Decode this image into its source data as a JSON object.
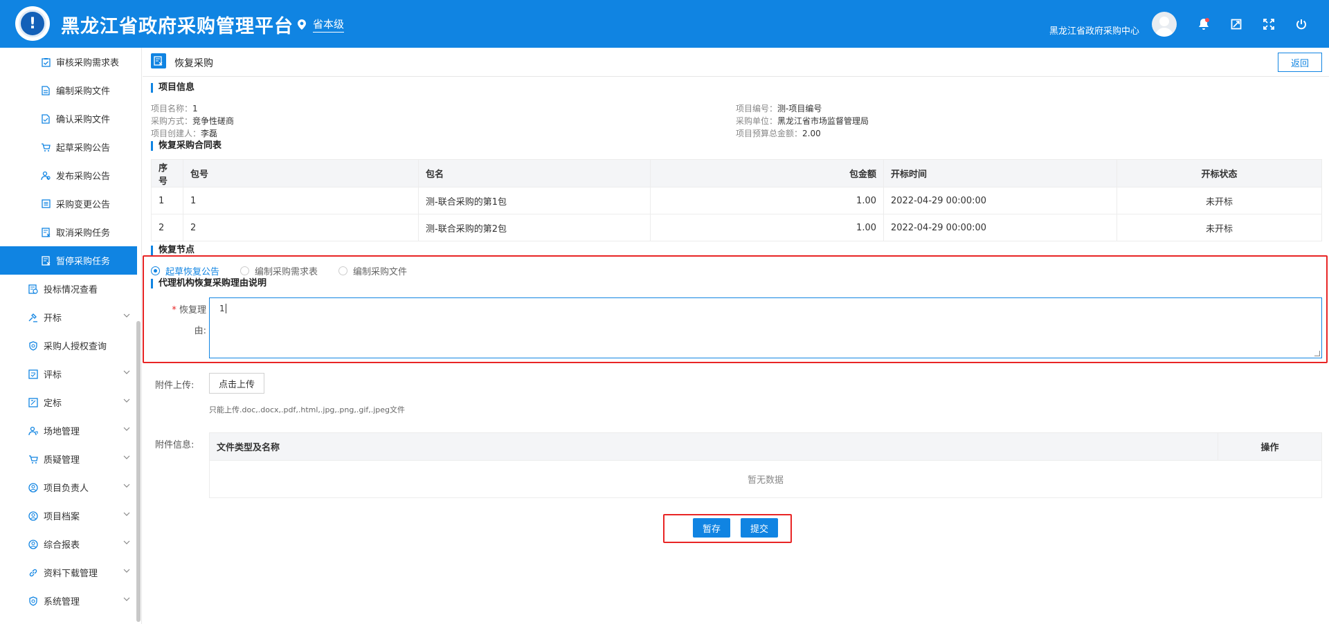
{
  "header": {
    "app_title": "黑龙江省政府采购管理平台",
    "region": "省本级",
    "user_org": "黑龙江省政府采购中心",
    "bg_color": "#1084e2"
  },
  "sidebar": {
    "sub_items": [
      {
        "label": "审核采购需求表",
        "icon": "checklist-icon"
      },
      {
        "label": "编制采购文件",
        "icon": "document-icon"
      },
      {
        "label": "确认采购文件",
        "icon": "document-check-icon"
      },
      {
        "label": "起草采购公告",
        "icon": "cart-icon"
      },
      {
        "label": "发布采购公告",
        "icon": "users-icon"
      },
      {
        "label": "采购变更公告",
        "icon": "list-icon"
      },
      {
        "label": "取消采购任务",
        "icon": "cancel-doc-icon"
      },
      {
        "label": "暂停采购任务",
        "icon": "pause-doc-icon",
        "active": true
      }
    ],
    "top_items": [
      {
        "label": "投标情况查看",
        "icon": "bid-icon",
        "expandable": false
      },
      {
        "label": "开标",
        "icon": "hammer-icon",
        "expandable": true
      },
      {
        "label": "采购人授权查询",
        "icon": "shield-icon",
        "expandable": false
      },
      {
        "label": "评标",
        "icon": "evaluate-icon",
        "expandable": true
      },
      {
        "label": "定标",
        "icon": "award-icon",
        "expandable": true
      },
      {
        "label": "场地管理",
        "icon": "venue-icon",
        "expandable": true
      },
      {
        "label": "质疑管理",
        "icon": "cart-icon",
        "expandable": true
      },
      {
        "label": "项目负责人",
        "icon": "user-circle-icon",
        "expandable": true
      },
      {
        "label": "项目档案",
        "icon": "user-circle-icon",
        "expandable": true
      },
      {
        "label": "综合报表",
        "icon": "user-circle-icon",
        "expandable": true
      },
      {
        "label": "资料下载管理",
        "icon": "link-icon",
        "expandable": true
      },
      {
        "label": "系统管理",
        "icon": "settings-shield-icon",
        "expandable": true
      }
    ]
  },
  "page": {
    "title": "恢复采购",
    "back_label": "返回"
  },
  "project_info": {
    "section_title": "项目信息",
    "name_label": "项目名称：",
    "name": "1",
    "method_label": "采购方式：",
    "method": "竞争性磋商",
    "creator_label": "项目创建人：",
    "creator": "李磊",
    "code_label": "项目编号：",
    "code": "测-项目编号",
    "unit_label": "采购单位：",
    "unit": "黑龙江省市场监督管理局",
    "budget_label": "项目预算总金额：",
    "budget": "2.00"
  },
  "contract_table": {
    "section_title": "恢复采购合同表",
    "headers": {
      "seq": "序号",
      "pkg_no": "包号",
      "pkg_name": "包名",
      "amount": "包金额",
      "open_time": "开标时间",
      "status": "开标状态"
    },
    "rows": [
      {
        "seq": "1",
        "pkg_no": "1",
        "pkg_name": "测-联合采购的第1包",
        "amount": "1.00",
        "open_time": "2022-04-29 00:00:00",
        "status": "未开标"
      },
      {
        "seq": "2",
        "pkg_no": "2",
        "pkg_name": "测-联合采购的第2包",
        "amount": "1.00",
        "open_time": "2022-04-29 00:00:00",
        "status": "未开标"
      }
    ]
  },
  "restore_node": {
    "section_title": "恢复节点",
    "options": [
      "起草恢复公告",
      "编制采购需求表",
      "编制采购文件"
    ],
    "selected": "起草恢复公告"
  },
  "reason": {
    "section_title": "代理机构恢复采购理由说明",
    "label_line1": "恢复理",
    "label_line2": "由:",
    "required_mark": "*",
    "value": "1"
  },
  "attachment": {
    "upload_label": "附件上传:",
    "upload_button": "点击上传",
    "hint": "只能上传.doc,.docx,.pdf,.html,.jpg,.png,.gif,.jpeg文件",
    "info_label": "附件信息:",
    "col_name": "文件类型及名称",
    "col_action": "操作",
    "empty_text": "暂无数据"
  },
  "actions": {
    "save_label": "暂存",
    "submit_label": "提交"
  },
  "highlight_color": "#e82424"
}
